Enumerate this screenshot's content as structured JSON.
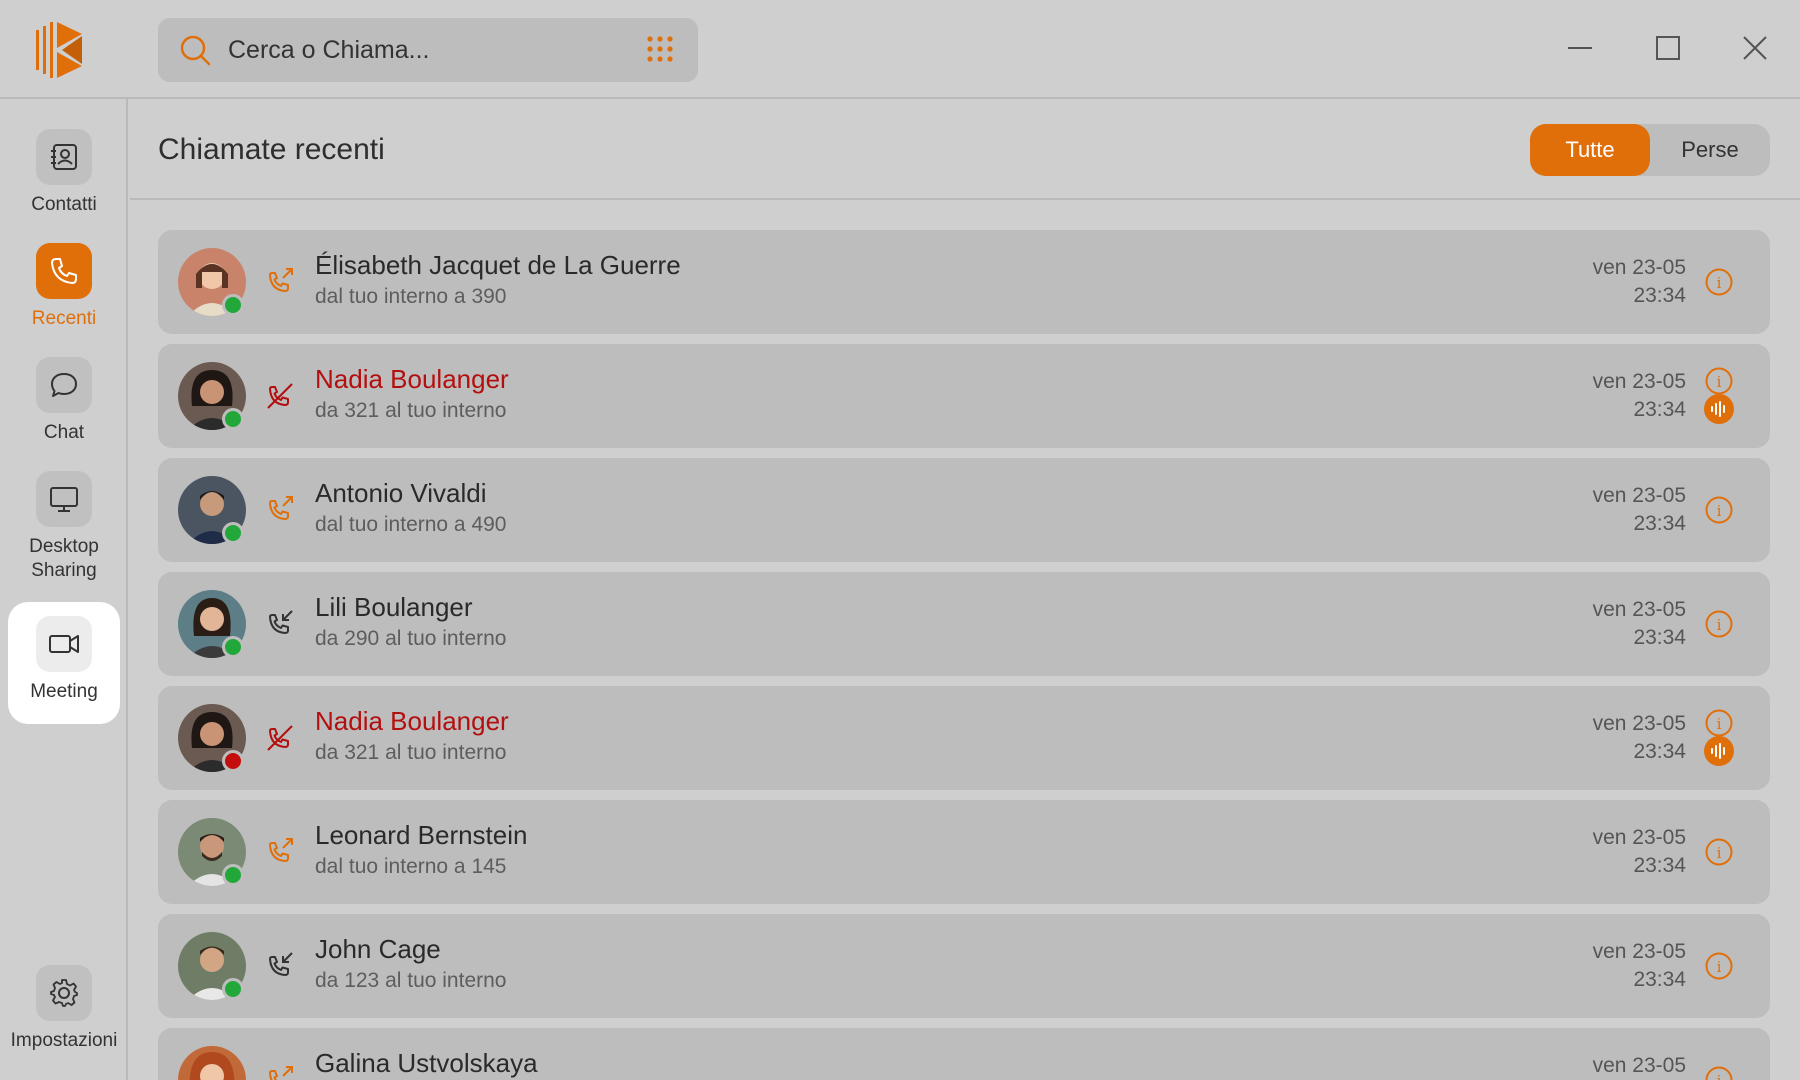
{
  "search": {
    "placeholder": "Cerca o Chiama..."
  },
  "sidebar": {
    "items": [
      {
        "label": "Contatti",
        "icon": "contacts-icon"
      },
      {
        "label": "Recenti",
        "icon": "phone-icon"
      },
      {
        "label": "Chat",
        "icon": "chat-icon"
      },
      {
        "label": "Desktop Sharing",
        "icon": "monitor-icon"
      },
      {
        "label": "Meeting",
        "icon": "video-icon"
      },
      {
        "label": "Impostazioni",
        "icon": "gear-icon"
      }
    ]
  },
  "main": {
    "title": "Chiamate recenti",
    "filters": [
      "Tutte",
      "Perse"
    ],
    "calls": [
      {
        "name": "Élisabeth Jacquet de La Guerre",
        "detail": "dal tuo interno a 390",
        "day": "ven 23-05",
        "time": "23:34",
        "type": "outgoing",
        "presence": "online",
        "recording": false
      },
      {
        "name": "Nadia Boulanger",
        "detail": "da 321 al tuo interno",
        "day": "ven 23-05",
        "time": "23:34",
        "type": "missed",
        "presence": "online",
        "recording": true
      },
      {
        "name": "Antonio Vivaldi",
        "detail": "dal tuo interno a 490",
        "day": "ven 23-05",
        "time": "23:34",
        "type": "outgoing",
        "presence": "online",
        "recording": false
      },
      {
        "name": "Lili Boulanger",
        "detail": "da 290 al tuo interno",
        "day": "ven 23-05",
        "time": "23:34",
        "type": "incoming",
        "presence": "online",
        "recording": false
      },
      {
        "name": "Nadia Boulanger",
        "detail": "da 321 al tuo interno",
        "day": "ven 23-05",
        "time": "23:34",
        "type": "missed",
        "presence": "busy",
        "recording": true
      },
      {
        "name": "Leonard Bernstein",
        "detail": "dal tuo interno a 145",
        "day": "ven 23-05",
        "time": "23:34",
        "type": "outgoing",
        "presence": "online",
        "recording": false
      },
      {
        "name": "John Cage",
        "detail": "da 123 al tuo interno",
        "day": "ven 23-05",
        "time": "23:34",
        "type": "incoming",
        "presence": "online",
        "recording": false
      },
      {
        "name": "Galina Ustvolskaya",
        "detail": "",
        "day": "ven 23-05",
        "time": "",
        "type": "outgoing",
        "presence": "online",
        "recording": false
      }
    ]
  },
  "colors": {
    "accent": "#e06f0a",
    "missed": "#b30f0f",
    "online": "#22a83a",
    "busy": "#c40e0e"
  }
}
